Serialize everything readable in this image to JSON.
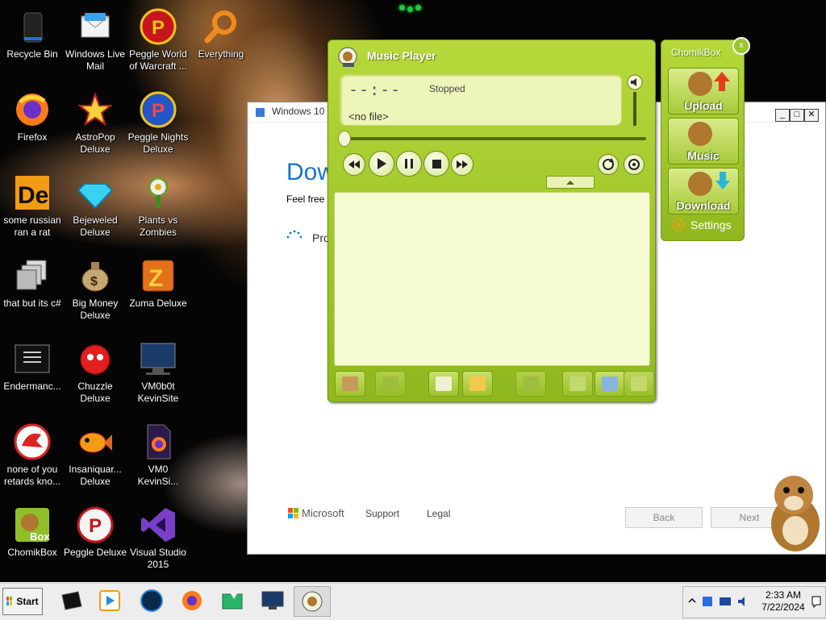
{
  "desktop": {
    "icons": [
      {
        "label": "Recycle Bin",
        "icon": "recycle-bin-icon"
      },
      {
        "label": "Windows Live\nMail",
        "icon": "mail-icon"
      },
      {
        "label": "Peggle World\nof Warcraft ...",
        "icon": "peggle-icon"
      },
      {
        "label": "Everything",
        "icon": "search-icon"
      },
      {
        "label": "Firefox",
        "icon": "firefox-icon"
      },
      {
        "label": "AstroPop\nDeluxe",
        "icon": "astropop-icon"
      },
      {
        "label": "Peggle Nights\nDeluxe",
        "icon": "peggle-icon"
      },
      {
        "label": "some russian\nran a rat",
        "icon": "de-icon"
      },
      {
        "label": "Bejeweled\nDeluxe",
        "icon": "gem-icon"
      },
      {
        "label": "Plants vs\nZombies",
        "icon": "plant-icon"
      },
      {
        "label": "that but its c#",
        "icon": "windows-stack-icon"
      },
      {
        "label": "Big Money\nDeluxe",
        "icon": "money-bag-icon"
      },
      {
        "label": "Zuma Deluxe",
        "icon": "zuma-icon"
      },
      {
        "label": "Endermanc...",
        "icon": "terminal-icon"
      },
      {
        "label": "Chuzzle\nDeluxe",
        "icon": "chuzzle-icon"
      },
      {
        "label": "VM0b0t\nKevinSite",
        "icon": "monitor-icon"
      },
      {
        "label": "none of you\nretards kno...",
        "icon": "dragon-icon"
      },
      {
        "label": "Insaniquar...\nDeluxe",
        "icon": "fish-icon"
      },
      {
        "label": "VM0\nKevinSi...",
        "icon": "firefox-file-icon"
      },
      {
        "label": "ChomikBox",
        "icon": "chomikbox-icon"
      },
      {
        "label": "Peggle Deluxe",
        "icon": "peggle-icon"
      },
      {
        "label": "Visual Studio\n2015",
        "icon": "visual-studio-icon"
      }
    ]
  },
  "setup_window": {
    "title": "Windows 10 S",
    "heading": "Dow",
    "subtext": "Feel free t",
    "progress": "Pro",
    "brand": "Microsoft",
    "support": "Support",
    "legal": "Legal",
    "back": "Back",
    "next": "Next",
    "minimize": "_",
    "maximize": "□",
    "close": "✕"
  },
  "player": {
    "title": "Music Player",
    "time": "--:--",
    "status": "Stopped",
    "file": "<no file>"
  },
  "chomikbox": {
    "title": "ChomikBox",
    "close": "x",
    "upload": "Upload",
    "music": "Music",
    "download": "Download",
    "settings": "Settings"
  },
  "taskbar": {
    "start": "Start",
    "time": "2:33 AM",
    "date": "7/22/2024"
  },
  "colors": {
    "accent_green": "#9fc22c",
    "setup_blue": "#1a73c7"
  }
}
